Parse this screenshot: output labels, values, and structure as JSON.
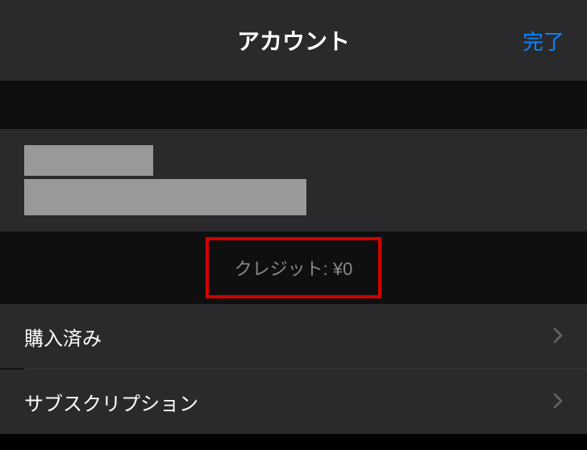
{
  "header": {
    "title": "アカウント",
    "done": "完了"
  },
  "credit": {
    "label": "クレジット: ¥0"
  },
  "menu": {
    "purchased": "購入済み",
    "subscription": "サブスクリプション"
  }
}
